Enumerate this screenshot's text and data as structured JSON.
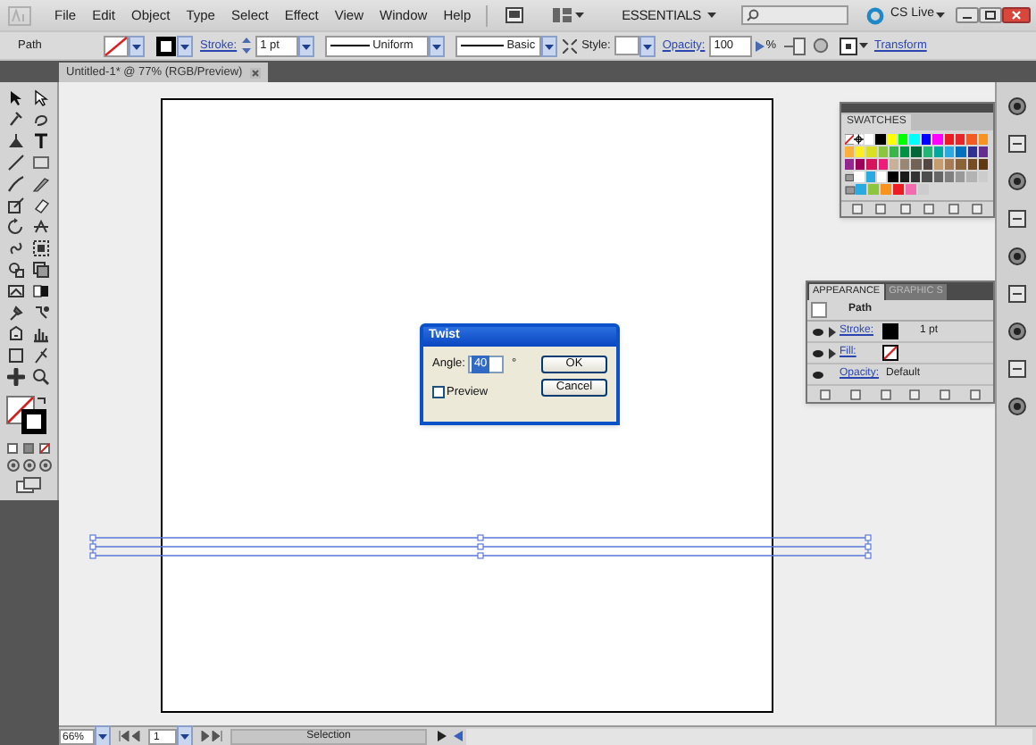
{
  "menu_bar": {
    "items": [
      "File",
      "Edit",
      "Object",
      "Type",
      "Select",
      "Effect",
      "View",
      "Window",
      "Help"
    ],
    "workspace": "ESSENTIALS",
    "cs_live": "CS Live"
  },
  "control_bar": {
    "selection": "Path",
    "stroke_label": "Stroke:",
    "stroke_weight": "1 pt",
    "profile": "Uniform",
    "brush": "Basic",
    "style_label": "Style:",
    "opacity_label": "Opacity:",
    "opacity": "100",
    "percent": "%",
    "transform": "Transform"
  },
  "document_tab": {
    "title": "Untitled-1* @ 77% (RGB/Preview)"
  },
  "swatches_panel": {
    "title": "SWATCHES",
    "rows": [
      {
        "swatches": [
          {
            "kind": "none"
          },
          {
            "kind": "registration"
          },
          {
            "color": "#ffffff"
          },
          {
            "color": "#000000"
          },
          {
            "color": "#ffff00"
          },
          {
            "color": "#00ff00"
          },
          {
            "color": "#00ffff"
          },
          {
            "color": "#0000ff"
          },
          {
            "color": "#ff00ff"
          },
          {
            "color": "#ed1c24"
          },
          {
            "color": "#e8252a"
          },
          {
            "color": "#f15a24"
          },
          {
            "color": "#f7931e"
          }
        ]
      },
      {
        "swatches": [
          {
            "color": "#fbb03b"
          },
          {
            "color": "#fcee21"
          },
          {
            "color": "#d9e021"
          },
          {
            "color": "#8cc63f"
          },
          {
            "color": "#39b54a"
          },
          {
            "color": "#009245"
          },
          {
            "color": "#006837"
          },
          {
            "color": "#22b573"
          },
          {
            "color": "#00a99d"
          },
          {
            "color": "#29abe2"
          },
          {
            "color": "#0071bc"
          },
          {
            "color": "#2e3192"
          },
          {
            "color": "#662d91"
          }
        ]
      },
      {
        "swatches": [
          {
            "color": "#93278f"
          },
          {
            "color": "#9e005d"
          },
          {
            "color": "#d4145a"
          },
          {
            "color": "#ed1e79"
          },
          {
            "color": "#c7b299"
          },
          {
            "color": "#998675"
          },
          {
            "color": "#736357"
          },
          {
            "color": "#534741"
          },
          {
            "color": "#c69c6d"
          },
          {
            "color": "#a67c52"
          },
          {
            "color": "#8c6239"
          },
          {
            "color": "#754c24"
          },
          {
            "color": "#603813"
          }
        ]
      },
      {
        "swatches": [
          {
            "kind": "group"
          },
          {
            "color": "#ffffff"
          },
          {
            "color": "#29abe2"
          },
          {
            "color": "#ffffff"
          },
          {
            "color": "#000000"
          },
          {
            "color": "#1a1a1a"
          },
          {
            "color": "#333333"
          },
          {
            "color": "#4d4d4d"
          },
          {
            "color": "#666666"
          },
          {
            "color": "#808080"
          },
          {
            "color": "#999999"
          },
          {
            "color": "#b3b3b3"
          },
          {
            "color": "#cccccc"
          }
        ]
      },
      {
        "swatches": [
          {
            "kind": "group"
          },
          {
            "color": "#29abe2"
          },
          {
            "color": "#8cc63f"
          },
          {
            "color": "#f7931e"
          },
          {
            "color": "#ed1c24"
          },
          {
            "color": "#f26cb0"
          },
          {
            "color": "#cccccc"
          }
        ]
      }
    ]
  },
  "appearance_panel": {
    "tabs": [
      {
        "label": "APPEARANCE",
        "selected": true
      },
      {
        "label": "GRAPHIC S",
        "selected": false
      }
    ],
    "object": "Path",
    "rows": [
      {
        "kind": "stroke",
        "label": "Stroke:",
        "value": "1 pt"
      },
      {
        "kind": "fill",
        "label": "Fill:"
      },
      {
        "kind": "opacity",
        "label": "Opacity:",
        "value": "Default"
      }
    ]
  },
  "dialog": {
    "title": "Twist",
    "angle_label": "Angle:",
    "angle": "40",
    "unit": "°",
    "preview": {
      "label": "Preview",
      "checked": false
    },
    "buttons": [
      "OK",
      "Cancel"
    ]
  },
  "status_bar": {
    "zoom": "66%",
    "artboard": "1",
    "tool": "Selection"
  }
}
